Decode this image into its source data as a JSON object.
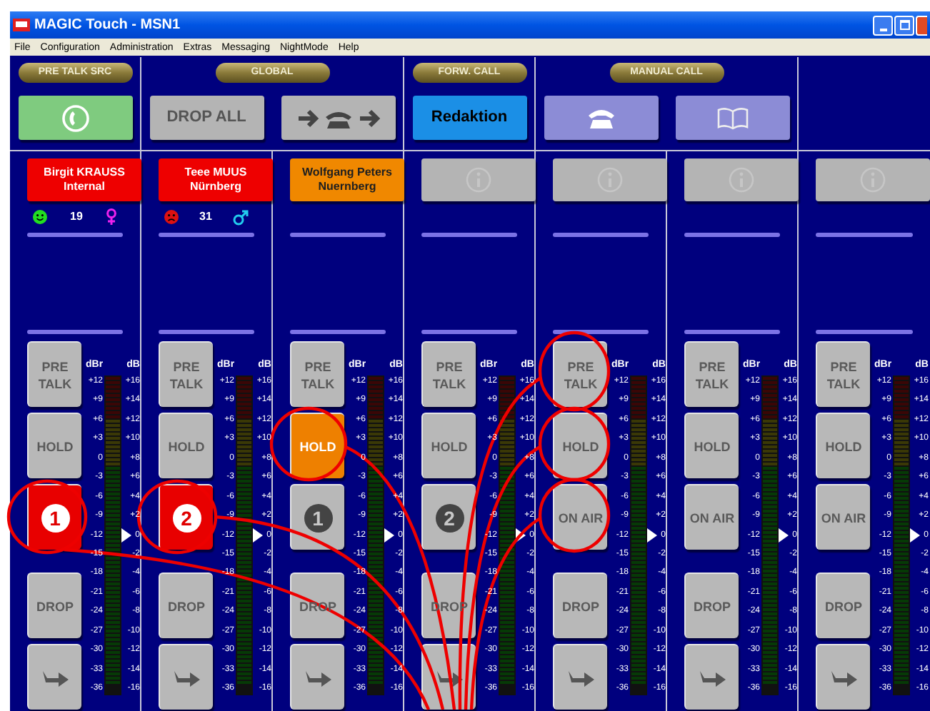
{
  "window": {
    "title": "MAGIC Touch - MSN1"
  },
  "menu": [
    "File",
    "Configuration",
    "Administration",
    "Extras",
    "Messaging",
    "NightMode",
    "Help"
  ],
  "sections": [
    {
      "title": "PRE TALK SRC",
      "buttons": [
        {
          "kind": "handset",
          "color": "#7fcb7f"
        }
      ]
    },
    {
      "title": "GLOBAL",
      "buttons": [
        {
          "kind": "text",
          "label": "DROP ALL",
          "color": "#b4b4b4"
        },
        {
          "kind": "transfer",
          "color": "#b4b4b4"
        }
      ]
    },
    {
      "title": "FORW. CALL",
      "buttons": [
        {
          "kind": "text",
          "label": "Redaktion",
          "color": "#1b8fe6"
        }
      ]
    },
    {
      "title": "MANUAL CALL",
      "buttons": [
        {
          "kind": "phone",
          "color": "#8c8cd6"
        },
        {
          "kind": "book",
          "color": "#8c8cd6"
        }
      ]
    }
  ],
  "strips": [
    {
      "caller": {
        "name": "Birgit KRAUSS",
        "location": "Internal",
        "color": "#ee0000"
      },
      "status": {
        "happy": true,
        "count": "19",
        "female": true
      },
      "buttons": [
        {
          "kind": "pretalk",
          "label": "PRE TALK",
          "selected": false
        },
        {
          "kind": "hold",
          "label": "HOLD",
          "selected": false
        },
        {
          "kind": "line",
          "label": "1",
          "selected": true
        },
        {
          "kind": "drop",
          "label": "DROP",
          "selected": false
        },
        {
          "kind": "forward",
          "selected": false
        }
      ],
      "meter": {
        "dbr_header": "dBr",
        "db_header": "dB",
        "dbr_scale": [
          "+12",
          "+9",
          "+6",
          "+3",
          "0",
          "-3",
          "-6",
          "-9",
          "-12",
          "-15",
          "-18",
          "-21",
          "-24",
          "-27",
          "-30",
          "-33",
          "-36"
        ],
        "db_scale": [
          "+16",
          "+14",
          "+12",
          "+10",
          "+8",
          "+6",
          "+4",
          "+2",
          "0",
          "-2",
          "-4",
          "-6",
          "-8",
          "-10",
          "-12",
          "-14",
          "-16"
        ]
      }
    },
    {
      "caller": {
        "name": "Teee MUUS",
        "location": "Nürnberg",
        "color": "#ee0000"
      },
      "status": {
        "happy": false,
        "count": "31",
        "female": false
      },
      "buttons": [
        {
          "kind": "pretalk",
          "label": "PRE TALK",
          "selected": false
        },
        {
          "kind": "hold",
          "label": "HOLD",
          "selected": false
        },
        {
          "kind": "line",
          "label": "2",
          "selected": true
        },
        {
          "kind": "drop",
          "label": "DROP",
          "selected": false
        },
        {
          "kind": "forward",
          "selected": false
        }
      ],
      "meter": {
        "dbr_header": "dBr",
        "db_header": "dB",
        "dbr_scale": [
          "+12",
          "+9",
          "+6",
          "+3",
          "0",
          "-3",
          "-6",
          "-9",
          "-12",
          "-15",
          "-18",
          "-21",
          "-24",
          "-27",
          "-30",
          "-33",
          "-36"
        ],
        "db_scale": [
          "+16",
          "+14",
          "+12",
          "+10",
          "+8",
          "+6",
          "+4",
          "+2",
          "0",
          "-2",
          "-4",
          "-6",
          "-8",
          "-10",
          "-12",
          "-14",
          "-16"
        ]
      }
    },
    {
      "caller": {
        "name": "Wolfgang Peters",
        "location": "Nuernberg",
        "color": "#f08800"
      },
      "buttons": [
        {
          "kind": "pretalk",
          "label": "PRE TALK",
          "selected": false
        },
        {
          "kind": "hold",
          "label": "HOLD",
          "selected": true
        },
        {
          "kind": "line",
          "label": "1",
          "selected": false
        },
        {
          "kind": "drop",
          "label": "DROP",
          "selected": false
        },
        {
          "kind": "forward",
          "selected": false
        }
      ],
      "meter": {
        "dbr_header": "dBr",
        "db_header": "dB",
        "dbr_scale": [
          "+12",
          "+9",
          "+6",
          "+3",
          "0",
          "-3",
          "-6",
          "-9",
          "-12",
          "-15",
          "-18",
          "-21",
          "-24",
          "-27",
          "-30",
          "-33",
          "-36"
        ],
        "db_scale": [
          "+16",
          "+14",
          "+12",
          "+10",
          "+8",
          "+6",
          "+4",
          "+2",
          "0",
          "-2",
          "-4",
          "-6",
          "-8",
          "-10",
          "-12",
          "-14",
          "-16"
        ]
      }
    },
    {
      "buttons": [
        {
          "kind": "pretalk",
          "label": "PRE TALK",
          "selected": false
        },
        {
          "kind": "hold",
          "label": "HOLD",
          "selected": false
        },
        {
          "kind": "line",
          "label": "2",
          "selected": false
        },
        {
          "kind": "drop",
          "label": "DROP",
          "selected": false
        },
        {
          "kind": "forward",
          "selected": false
        }
      ],
      "meter": {
        "dbr_header": "dBr",
        "db_header": "dB",
        "dbr_scale": [
          "+12",
          "+9",
          "+6",
          "+3",
          "0",
          "-3",
          "-6",
          "-9",
          "-12",
          "-15",
          "-18",
          "-21",
          "-24",
          "-27",
          "-30",
          "-33",
          "-36"
        ],
        "db_scale": [
          "+16",
          "+14",
          "+12",
          "+10",
          "+8",
          "+6",
          "+4",
          "+2",
          "0",
          "-2",
          "-4",
          "-6",
          "-8",
          "-10",
          "-12",
          "-14",
          "-16"
        ]
      }
    },
    {
      "buttons": [
        {
          "kind": "pretalk",
          "label": "PRE TALK",
          "selected": false
        },
        {
          "kind": "hold",
          "label": "HOLD",
          "selected": false
        },
        {
          "kind": "onair",
          "label": "ON AIR",
          "selected": false
        },
        {
          "kind": "drop",
          "label": "DROP",
          "selected": false
        },
        {
          "kind": "forward",
          "selected": false
        }
      ],
      "meter": {
        "dbr_header": "dBr",
        "db_header": "dB",
        "dbr_scale": [
          "+12",
          "+9",
          "+6",
          "+3",
          "0",
          "-3",
          "-6",
          "-9",
          "-12",
          "-15",
          "-18",
          "-21",
          "-24",
          "-27",
          "-30",
          "-33",
          "-36"
        ],
        "db_scale": [
          "+16",
          "+14",
          "+12",
          "+10",
          "+8",
          "+6",
          "+4",
          "+2",
          "0",
          "-2",
          "-4",
          "-6",
          "-8",
          "-10",
          "-12",
          "-14",
          "-16"
        ]
      }
    },
    {
      "buttons": [
        {
          "kind": "pretalk",
          "label": "PRE TALK",
          "selected": false
        },
        {
          "kind": "hold",
          "label": "HOLD",
          "selected": false
        },
        {
          "kind": "onair",
          "label": "ON AIR",
          "selected": false
        },
        {
          "kind": "drop",
          "label": "DROP",
          "selected": false
        },
        {
          "kind": "forward",
          "selected": false
        }
      ],
      "meter": {
        "dbr_header": "dBr",
        "db_header": "dB",
        "dbr_scale": [
          "+12",
          "+9",
          "+6",
          "+3",
          "0",
          "-3",
          "-6",
          "-9",
          "-12",
          "-15",
          "-18",
          "-21",
          "-24",
          "-27",
          "-30",
          "-33",
          "-36"
        ],
        "db_scale": [
          "+16",
          "+14",
          "+12",
          "+10",
          "+8",
          "+6",
          "+4",
          "+2",
          "0",
          "-2",
          "-4",
          "-6",
          "-8",
          "-10",
          "-12",
          "-14",
          "-16"
        ]
      }
    },
    {
      "buttons": [
        {
          "kind": "pretalk",
          "label": "PRE TALK",
          "selected": false
        },
        {
          "kind": "hold",
          "label": "HOLD",
          "selected": false
        },
        {
          "kind": "onair",
          "label": "ON AIR",
          "selected": false
        },
        {
          "kind": "drop",
          "label": "DROP",
          "selected": false
        },
        {
          "kind": "forward",
          "selected": false
        }
      ],
      "meter": {
        "dbr_header": "dBr",
        "db_header": "dB",
        "dbr_scale": [
          "+12",
          "+9",
          "+6",
          "+3",
          "0",
          "-3",
          "-6",
          "-9",
          "-12",
          "-15",
          "-18",
          "-21",
          "-24",
          "-27",
          "-30",
          "-33",
          "-36"
        ],
        "db_scale": [
          "+16",
          "+14",
          "+12",
          "+10",
          "+8",
          "+6",
          "+4",
          "+2",
          "0",
          "-2",
          "-4",
          "-6",
          "-8",
          "-10",
          "-12",
          "-14",
          "-16"
        ]
      }
    }
  ]
}
